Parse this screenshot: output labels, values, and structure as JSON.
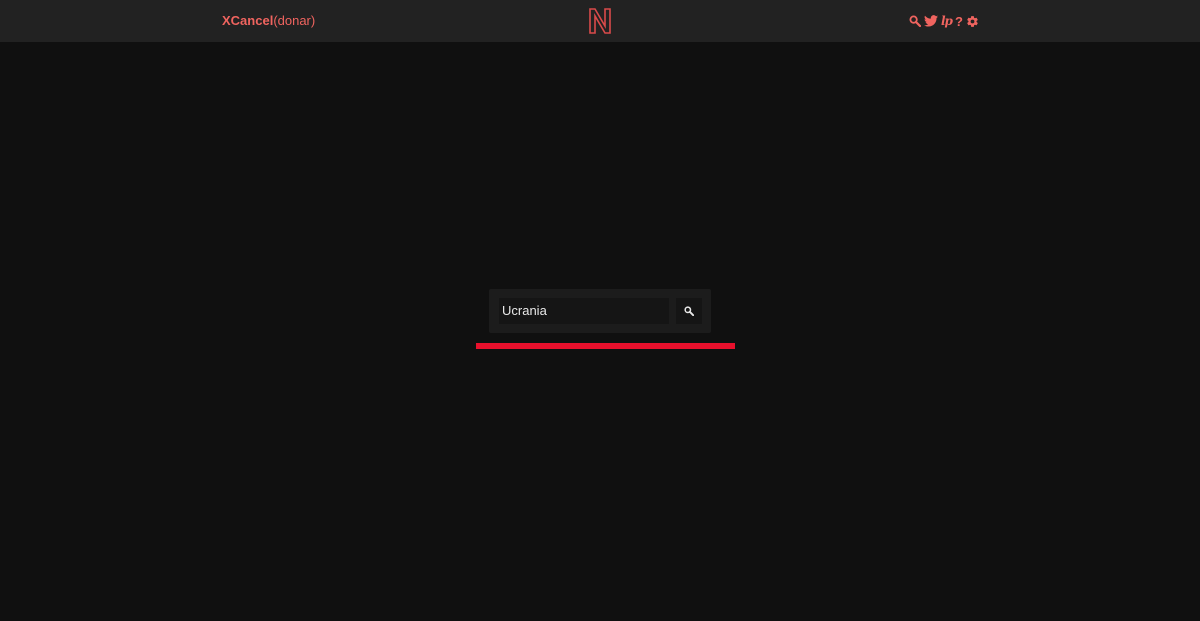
{
  "navbar": {
    "brand_name": "XCancel",
    "donate_label": "(donar)",
    "icons": [
      "search-icon",
      "twitter-bird-icon",
      "rss-icon",
      "help-icon",
      "gear-icon"
    ],
    "rss_glyph": "lp",
    "help_glyph": "?"
  },
  "search": {
    "value": "Ucrania",
    "button_icon": "search-icon"
  },
  "colors": {
    "accent": "#f0645f",
    "underline": "#e8102c",
    "background": "#101010",
    "navbar": "#222222"
  }
}
